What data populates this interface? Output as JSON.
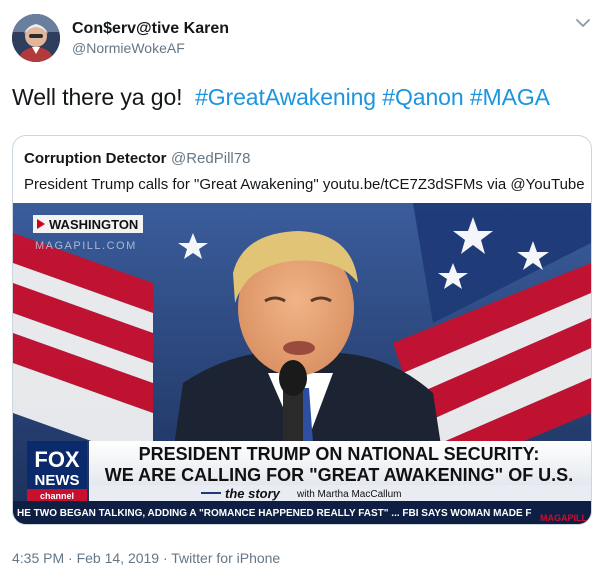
{
  "tweet": {
    "author_name": "Con$erv@tive Karen",
    "author_handle": "@NormieWokeAF",
    "text_plain": "Well there ya go!",
    "hashtags": [
      "#GreatAwakening",
      "#Qanon",
      "#MAGA"
    ],
    "timestamp": "4:35 PM · Feb 14, 2019 · Twitter for iPhone",
    "icons": {
      "avatar": "profile-avatar",
      "menu": "chevron-down-icon"
    }
  },
  "quoted": {
    "author_name": "Corruption Detector",
    "author_handle": "@RedPill78",
    "text": "President Trump calls for \"Great Awakening\" youtu.be/tCE7Z3dSFMs via @YouTube",
    "video": {
      "location_tag": "WASHINGTON",
      "watermark": "MAGAPILL.COM",
      "headline_line1": "PRESIDENT TRUMP ON NATIONAL SECURITY:",
      "headline_line2": "WE ARE CALLING FOR \"GREAT AWAKENING\" OF U.S.",
      "show_name": "the story",
      "show_host": "with Martha MacCallum",
      "logo_top": "FOX",
      "logo_middle": "NEWS",
      "logo_bottom": "channel",
      "ticker": "HE TWO BEGAN TALKING, ADDING A \"ROMANCE HAPPENED REALLY FAST\" ...   FBI SAYS WOMAN MADE F",
      "corner_watermark": "MAGAPILL"
    }
  },
  "colors": {
    "link": "#1b95e0",
    "secondary_text": "#657786",
    "border": "#ccd6dd"
  }
}
